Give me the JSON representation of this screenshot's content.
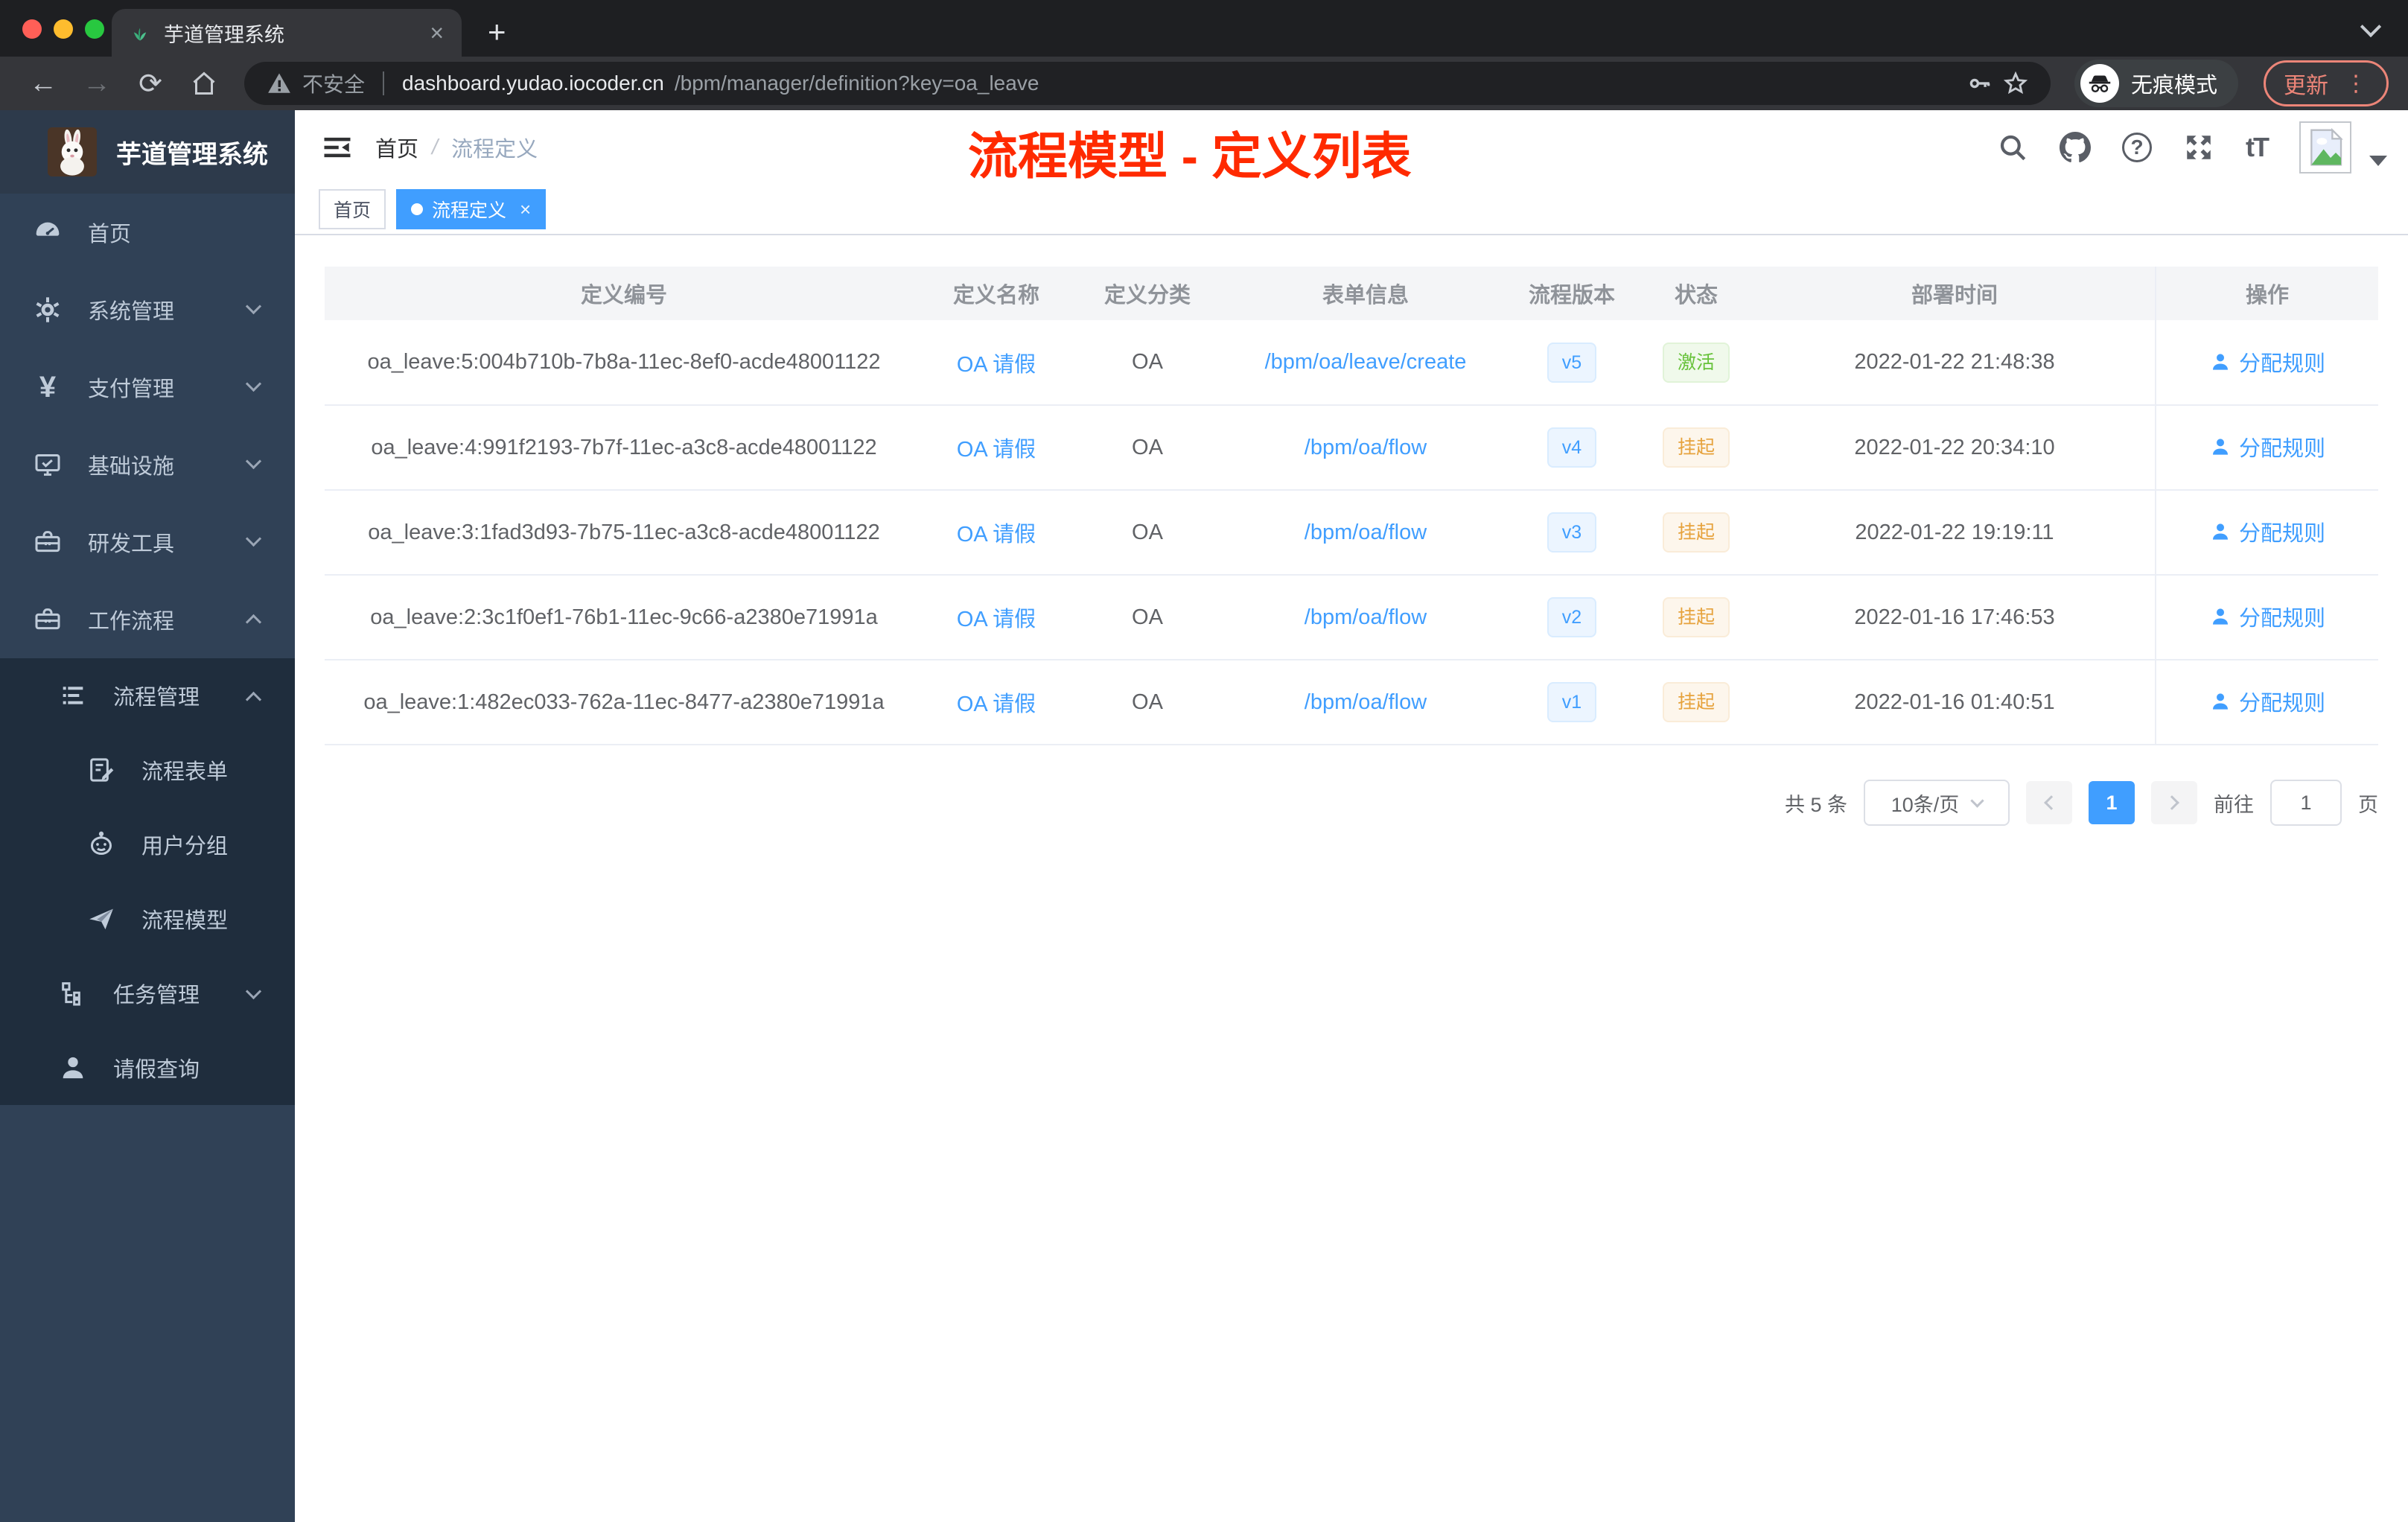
{
  "browser": {
    "tab_title": "芋道管理系统",
    "url": {
      "security_label": "不安全",
      "domain": "dashboard.yudao.iocoder.cn",
      "path": "/bpm/manager/definition?key=oa_leave"
    },
    "incognito_label": "无痕模式",
    "update_label": "更新"
  },
  "glyphs": {
    "back": "←",
    "forward": "→",
    "reload": "⟳",
    "plus": "+",
    "close": "×",
    "dots": "⋮",
    "star": "☆",
    "question": "?",
    "font_size": "tT",
    "yen": "¥"
  },
  "sidebar": {
    "app_title": "芋道管理系统",
    "items": [
      {
        "label": "首页",
        "icon": "dashboard-icon"
      },
      {
        "label": "系统管理",
        "icon": "gear-icon",
        "chevron": "down"
      },
      {
        "label": "支付管理",
        "icon": "yen-icon",
        "chevron": "down"
      },
      {
        "label": "基础设施",
        "icon": "monitor-icon",
        "chevron": "down"
      },
      {
        "label": "研发工具",
        "icon": "toolbox-icon",
        "chevron": "down"
      },
      {
        "label": "工作流程",
        "icon": "toolbox-icon",
        "chevron": "up"
      }
    ],
    "submenu": [
      {
        "label": "流程管理",
        "icon": "list-icon",
        "chevron": "up"
      },
      {
        "label": "流程表单",
        "icon": "form-icon"
      },
      {
        "label": "用户分组",
        "icon": "robot-icon"
      },
      {
        "label": "流程模型",
        "icon": "paper-plane-icon"
      },
      {
        "label": "任务管理",
        "icon": "tree-icon",
        "chevron": "down"
      },
      {
        "label": "请假查询",
        "icon": "person-icon"
      }
    ]
  },
  "header": {
    "breadcrumb": {
      "home": "首页",
      "separator": "/",
      "current": "流程定义"
    },
    "annotation": "流程模型 - 定义列表"
  },
  "tags": [
    {
      "label": "首页",
      "active": false
    },
    {
      "label": "流程定义",
      "active": true
    }
  ],
  "table": {
    "columns": [
      "定义编号",
      "定义名称",
      "定义分类",
      "表单信息",
      "流程版本",
      "状态",
      "部署时间",
      "操作"
    ],
    "action_label": "分配规则",
    "rows": [
      {
        "id": "oa_leave:5:004b710b-7b8a-11ec-8ef0-acde48001122",
        "name": "OA 请假",
        "category": "OA",
        "form": "/bpm/oa/leave/create",
        "version": "v5",
        "status": "激活",
        "status_type": "active",
        "deploy_time": "2022-01-22 21:48:38"
      },
      {
        "id": "oa_leave:4:991f2193-7b7f-11ec-a3c8-acde48001122",
        "name": "OA 请假",
        "category": "OA",
        "form": "/bpm/oa/flow",
        "version": "v4",
        "status": "挂起",
        "status_type": "suspended",
        "deploy_time": "2022-01-22 20:34:10"
      },
      {
        "id": "oa_leave:3:1fad3d93-7b75-11ec-a3c8-acde48001122",
        "name": "OA 请假",
        "category": "OA",
        "form": "/bpm/oa/flow",
        "version": "v3",
        "status": "挂起",
        "status_type": "suspended",
        "deploy_time": "2022-01-22 19:19:11"
      },
      {
        "id": "oa_leave:2:3c1f0ef1-76b1-11ec-9c66-a2380e71991a",
        "name": "OA 请假",
        "category": "OA",
        "form": "/bpm/oa/flow",
        "version": "v2",
        "status": "挂起",
        "status_type": "suspended",
        "deploy_time": "2022-01-16 17:46:53"
      },
      {
        "id": "oa_leave:1:482ec033-762a-11ec-8477-a2380e71991a",
        "name": "OA 请假",
        "category": "OA",
        "form": "/bpm/oa/flow",
        "version": "v1",
        "status": "挂起",
        "status_type": "suspended",
        "deploy_time": "2022-01-16 01:40:51"
      }
    ]
  },
  "pagination": {
    "total_text": "共 5 条",
    "page_size": "10条/页",
    "current_page": "1",
    "goto_label": "前往",
    "goto_value": "1",
    "page_unit": "页"
  },
  "colors": {
    "accent": "#409eff",
    "success": "#67c23a",
    "warning": "#e6a23c",
    "annotation": "#ff2a00",
    "sidebar_bg": "#304156",
    "submenu_bg": "#1f2d3d"
  }
}
